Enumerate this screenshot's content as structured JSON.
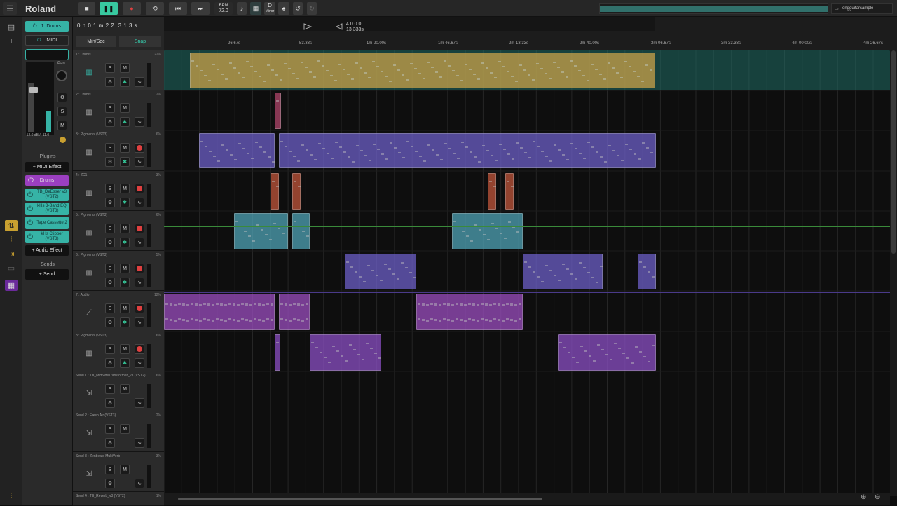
{
  "app": {
    "brand": "Roland",
    "menu_icon": "hamburger-icon"
  },
  "transport": {
    "bpm_label": "BPM",
    "bpm_value": "72.0",
    "key_label": "D",
    "key_mode": "Minor",
    "position": "0 h 0 1 m 2 2. 3 1 3 s",
    "loop_end": "4.0.0.0",
    "loop_len": "13.333s",
    "minsec": "Min/Sec",
    "snap": "Snap",
    "waveform_name": "longguitarsample"
  },
  "ruler": {
    "labels": [
      "26.67s",
      "53.33s",
      "1m 20.00s",
      "1m 46.67s",
      "2m 13.33s",
      "2m 40.00s",
      "3m 06.67s",
      "3m 33.33s",
      "4m 00.00s",
      "4m 26.67s"
    ]
  },
  "inspector": {
    "track_name": "1: Drums",
    "type": "MIDI",
    "pan_label": "Pan",
    "gain": "-12.0 dB / -11.0",
    "plugins_heading": "Plugins",
    "midi_effect": "+ MIDI Effect",
    "instrument": "Drums",
    "plugins": [
      {
        "name": "TB_DeEsser v3 (VST2)"
      },
      {
        "name": "kHs 3-Band EQ (VST3)"
      },
      {
        "name": "Tape Cassette 2"
      },
      {
        "name": "kHs Clipper (VST3)"
      }
    ],
    "audio_effect": "+ Audio Effect",
    "sends_heading": "Sends",
    "send_btn": "+ Send",
    "side_buttons": [
      "S",
      "M"
    ]
  },
  "tracks": [
    {
      "name": "1 : Drums",
      "pct": "22%"
    },
    {
      "name": "2 : Drums",
      "pct": "2%"
    },
    {
      "name": "3 : Pigments (VST3)",
      "pct": "6%"
    },
    {
      "name": "4 : ZC1",
      "pct": "3%"
    },
    {
      "name": "5 : Pigments (VST3)",
      "pct": "6%"
    },
    {
      "name": "6 : Pigments (VST3)",
      "pct": "5%"
    },
    {
      "name": "7 : Audio",
      "pct": "12%"
    },
    {
      "name": "8 : Pigments (VST3)",
      "pct": "6%"
    },
    {
      "name": "Send 1 : TB_MidSideTransformer_v3 (VST2)",
      "pct": "6%"
    },
    {
      "name": "Send 2 : Fresh Air (VST3)",
      "pct": "2%"
    },
    {
      "name": "Send 3 : Zenbeats MultiVerb",
      "pct": "3%"
    },
    {
      "name": "Send 4 : TB_Reverb_v3 (VST2)",
      "pct": "1%"
    }
  ],
  "labels": {
    "solo": "S",
    "mute": "M"
  },
  "colors": {
    "drums": "#c9a24a",
    "pigments": "#6c5fc7",
    "zc1": "#c0553a",
    "pig5": "#4fa3b5",
    "audio": "#9a4dbf",
    "pig8": "#8a4fc4",
    "accent": "#36b3a6"
  }
}
